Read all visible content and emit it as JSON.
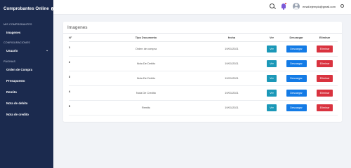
{
  "sidebar": {
    "brand": "Comprobantes Online",
    "sections": [
      {
        "label": "MIS COMPROBANTES",
        "items": [
          {
            "label": "Imagenes"
          }
        ]
      },
      {
        "label": "CONFIGURACIONES",
        "items": [
          {
            "label": "Usuario",
            "has_submenu": true
          }
        ]
      },
      {
        "label": "PÁGINAS",
        "items": [
          {
            "label": "Orden de Compra"
          },
          {
            "label": "Presupuesto"
          },
          {
            "label": "Remito"
          },
          {
            "label": "Nota de debito"
          },
          {
            "label": "Nota de credito"
          }
        ]
      }
    ]
  },
  "topbar": {
    "user_email": "email.ejemplo@gmail.com",
    "icons": [
      "search-icon",
      "bell-icon",
      "avatar",
      "gear-icon"
    ],
    "accent_color": "#7b59d6"
  },
  "card": {
    "title": "Imagenes",
    "columns": [
      "N°",
      "Tipo Documento",
      "fecha",
      "Ver",
      "Descargar",
      "Eliminar"
    ],
    "rows": [
      {
        "num": "1",
        "tipo": "Orden de compra",
        "fecha": "19/01/2021",
        "ver": "Ver",
        "descargar": "Descargar",
        "eliminar": "Eliminar"
      },
      {
        "num": "2",
        "tipo": "Nota De Debito",
        "fecha": "19/01/2021",
        "ver": "Ver",
        "descargar": "Descargar",
        "eliminar": "Eliminar"
      },
      {
        "num": "3",
        "tipo": "Nota De Debito",
        "fecha": "19/01/2021",
        "ver": "Ver",
        "descargar": "Descargar",
        "eliminar": "Eliminar"
      },
      {
        "num": "4",
        "tipo": "Nota De Credito",
        "fecha": "19/01/2021",
        "ver": "Ver",
        "descargar": "Descargar",
        "eliminar": "Eliminar"
      },
      {
        "num": "5",
        "tipo": "Remito",
        "fecha": "19/01/2021",
        "ver": "Ver",
        "descargar": "Descargar",
        "eliminar": "Eliminar"
      }
    ]
  },
  "colors": {
    "sidebar_bg": "#1b2a4e",
    "ver": "#1b98b8",
    "descargar": "#137be6",
    "eliminar": "#d9333f"
  }
}
